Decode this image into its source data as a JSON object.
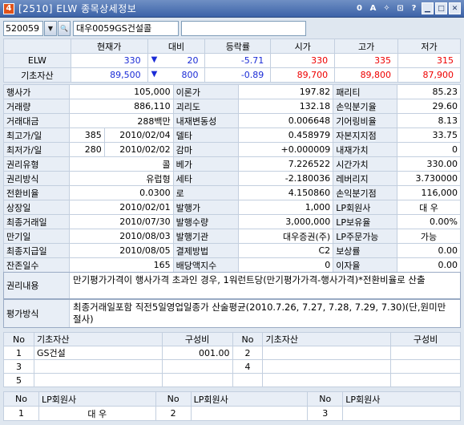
{
  "window": {
    "number": "4",
    "title": "[2510] ELW 종목상세정보",
    "tool_icons": [
      "0",
      "A",
      "✧",
      "⊡",
      "?"
    ]
  },
  "code": {
    "value": "520059",
    "name": "대우0059GS건설콜"
  },
  "quote": {
    "headers": [
      "현재가",
      "대비",
      "등락률",
      "시가",
      "고가",
      "저가"
    ],
    "rows": [
      {
        "label": "ELW",
        "price": "330",
        "change": "20",
        "rate": "-5.71",
        "open": "330",
        "high": "335",
        "low": "315"
      },
      {
        "label": "기초자산",
        "price": "89,500",
        "change": "800",
        "rate": "-0.89",
        "open": "89,700",
        "high": "89,800",
        "low": "87,900"
      }
    ]
  },
  "info": [
    [
      [
        "행사가",
        "105,000"
      ],
      [
        "이론가",
        "197.82"
      ],
      [
        "패리티",
        "85.23"
      ]
    ],
    [
      [
        "거래량",
        "886,110"
      ],
      [
        "괴리도",
        "132.18"
      ],
      [
        "손익분기율",
        "29.60"
      ]
    ],
    [
      [
        "거래대금",
        "288백만"
      ],
      [
        "내재변동성",
        "0.006648"
      ],
      [
        "기어링비율",
        "8.13"
      ]
    ],
    [
      [
        "최고가/일",
        "385",
        "2010/02/04"
      ],
      [
        "델타",
        "0.458979"
      ],
      [
        "자본지지점",
        "33.75"
      ]
    ],
    [
      [
        "최저가/일",
        "280",
        "2010/02/02"
      ],
      [
        "감마",
        "+0.000009"
      ],
      [
        "내재가치",
        "0"
      ]
    ],
    [
      [
        "권리유형",
        "콜"
      ],
      [
        "베가",
        "7.226522"
      ],
      [
        "시간가치",
        "330.00"
      ]
    ],
    [
      [
        "권리방식",
        "유럽형"
      ],
      [
        "세타",
        "-2.180036"
      ],
      [
        "레버리지",
        "3.730000"
      ]
    ],
    [
      [
        "전환비율",
        "0.0300"
      ],
      [
        "로",
        "4.150860"
      ],
      [
        "손익분기점",
        "116,000"
      ]
    ],
    [
      [
        "상장일",
        "2010/02/01"
      ],
      [
        "발행가",
        "1,000"
      ],
      [
        "LP회원사",
        "대  우"
      ]
    ],
    [
      [
        "최종거래일",
        "2010/07/30"
      ],
      [
        "발행수량",
        "3,000,000"
      ],
      [
        "LP보유율",
        "0.00%"
      ]
    ],
    [
      [
        "만기일",
        "2010/08/03"
      ],
      [
        "발행기관",
        "대우증권(주)"
      ],
      [
        "LP주문가능",
        "가능"
      ]
    ],
    [
      [
        "최종지급일",
        "2010/08/05"
      ],
      [
        "결제방법",
        "C2"
      ],
      [
        "보상률",
        "0.00"
      ]
    ],
    [
      [
        "잔존일수",
        "165"
      ],
      [
        "배당액지수",
        "0"
      ],
      [
        "이자율",
        "0.00"
      ]
    ]
  ],
  "rights": {
    "label": "권리내용",
    "text": "만기평가가격이 행사가격 초과인 경우, 1워런트당(만기평가가격-행사가격)*전환비율로 산출"
  },
  "evaluation": {
    "label": "평가방식",
    "text": "최종거래일포함 직전5일영업일종가 산술평균(2010.7.26, 7.27, 7.28, 7.29, 7.30)(단,원미만 절사)"
  },
  "underlying": {
    "headers": [
      "No",
      "기초자산",
      "구성비",
      "No",
      "기초자산",
      "구성비"
    ],
    "rows": [
      [
        "1",
        "GS건설",
        "001.00",
        "2",
        "",
        ""
      ],
      [
        "3",
        "",
        "",
        "4",
        "",
        ""
      ],
      [
        "5",
        "",
        "",
        "",
        "",
        ""
      ]
    ]
  },
  "lp": {
    "headers": [
      "No",
      "LP회원사",
      "No",
      "LP회원사",
      "No",
      "LP회원사"
    ],
    "row": [
      "1",
      "대  우",
      "2",
      "",
      "3",
      ""
    ]
  }
}
